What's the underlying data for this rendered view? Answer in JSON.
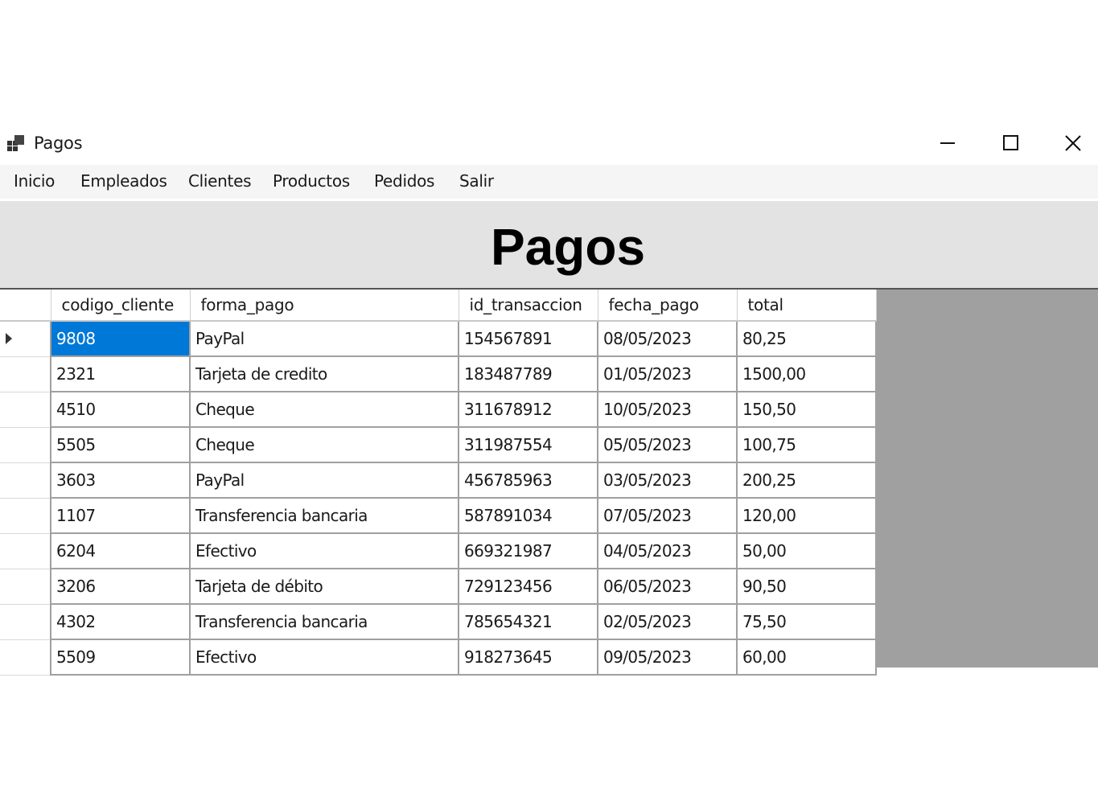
{
  "window": {
    "title": "Pagos"
  },
  "menu": {
    "items": [
      {
        "label": "Inicio"
      },
      {
        "label": "Empleados"
      },
      {
        "label": "Clientes"
      },
      {
        "label": "Productos"
      },
      {
        "label": "Pedidos"
      },
      {
        "label": "Salir"
      }
    ]
  },
  "header": {
    "title": "Pagos"
  },
  "grid": {
    "columns": [
      "codigo_cliente",
      "forma_pago",
      "id_transaccion",
      "fecha_pago",
      "total"
    ],
    "selected_row": 0,
    "selected_column": "codigo_cliente",
    "selection_color": "#0078d7",
    "rows": [
      [
        "9808",
        "PayPal",
        "154567891",
        "08/05/2023",
        "80,25"
      ],
      [
        "2321",
        "Tarjeta de credito",
        "183487789",
        "01/05/2023",
        "1500,00"
      ],
      [
        "4510",
        "Cheque",
        "311678912",
        "10/05/2023",
        "150,50"
      ],
      [
        "5505",
        "Cheque",
        "311987554",
        "05/05/2023",
        "100,75"
      ],
      [
        "3603",
        "PayPal",
        "456785963",
        "03/05/2023",
        "200,25"
      ],
      [
        "1107",
        "Transferencia bancaria",
        "587891034",
        "07/05/2023",
        "120,00"
      ],
      [
        "6204",
        "Efectivo",
        "669321987",
        "04/05/2023",
        "50,00"
      ],
      [
        "3206",
        "Tarjeta de débito",
        "729123456",
        "06/05/2023",
        "90,50"
      ],
      [
        "4302",
        "Transferencia bancaria",
        "785654321",
        "02/05/2023",
        "75,50"
      ],
      [
        "5509",
        "Efectivo",
        "918273645",
        "09/05/2023",
        "60,00"
      ]
    ]
  },
  "icons": {
    "app": "app-windows-icon",
    "minimize": "minimize-icon",
    "maximize": "maximize-icon",
    "close": "close-icon",
    "current_row": "current-row-arrow-icon"
  }
}
